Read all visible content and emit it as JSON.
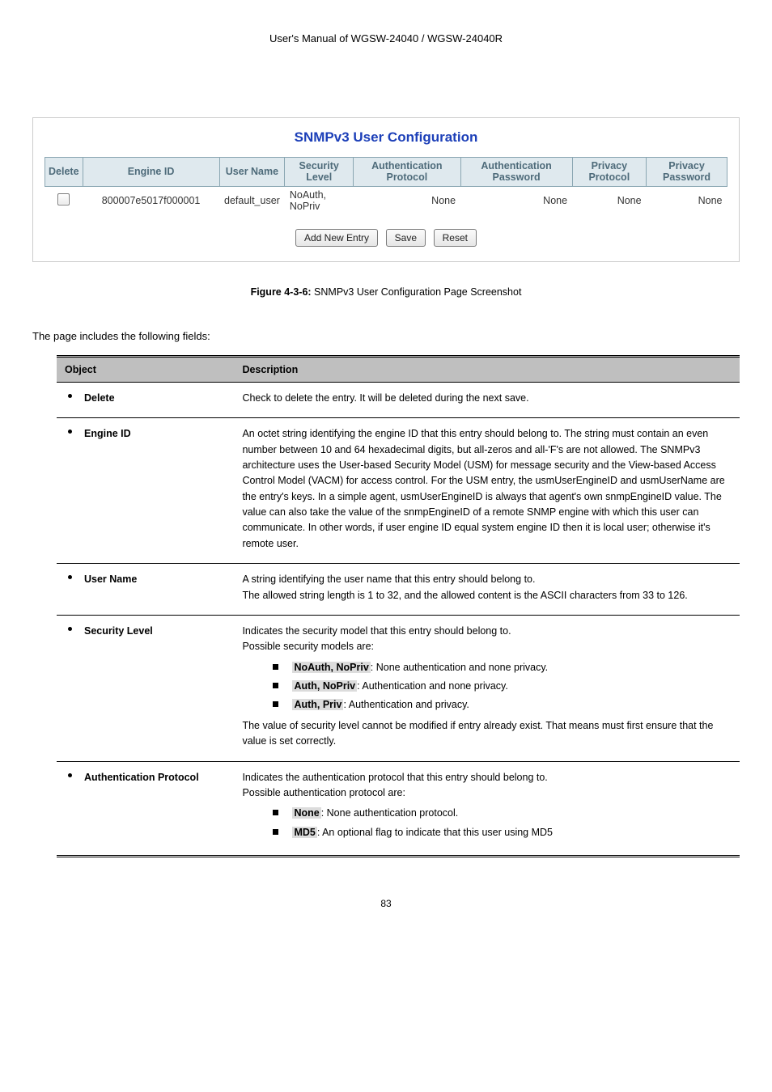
{
  "header_line": "User's Manual of WGSW-24040 / WGSW-24040R",
  "screenshot": {
    "title": "SNMPv3 User Configuration",
    "columns": [
      "Delete",
      "Engine ID",
      "User Name",
      "Security Level",
      "Authentication Protocol",
      "Authentication Password",
      "Privacy Protocol",
      "Privacy Password"
    ],
    "row": {
      "engine_id": "800007e5017f000001",
      "user_name": "default_user",
      "security_level": "NoAuth, NoPriv",
      "auth_protocol": "None",
      "auth_password": "None",
      "priv_protocol": "None",
      "priv_password": "None"
    },
    "buttons": {
      "add": "Add New Entry",
      "save": "Save",
      "reset": "Reset"
    }
  },
  "figure_caption_strong": "Figure 4-3-6:",
  "figure_caption_rest": " SNMPv3 User Configuration Page Screenshot",
  "lead": "The page includes the following fields:",
  "desc_table": {
    "head_object": "Object",
    "head_description": "Description",
    "rows": [
      {
        "name": "Delete",
        "desc_lines": [
          "Check to delete the entry. It will be deleted during the next save."
        ]
      },
      {
        "name": "Engine ID",
        "desc_lines": [
          "An octet string identifying the engine ID that this entry should belong to. The string must contain an even number between 10 and 64 hexadecimal digits, but all-zeros and all-'F's are not allowed. The SNMPv3 architecture uses the User-based Security Model (USM) for message security and the View-based Access Control Model (VACM) for access control. For the USM entry, the usmUserEngineID and usmUserName are the entry's keys. In a simple agent, usmUserEngineID is always that agent's own snmpEngineID value. The value can also take the value of the snmpEngineID of a remote SNMP engine with which this user can communicate. In other words, if user engine ID equal system engine ID then it is local user; otherwise it's remote user."
        ]
      },
      {
        "name": "User Name",
        "desc_lines": [
          "A string identifying the user name that this entry should belong to.",
          "The allowed string length is 1 to 32, and the allowed content is the ASCII characters from 33 to 126."
        ]
      },
      {
        "name": "Security Level",
        "desc_lines": [
          "Indicates the security model that this entry should belong to.",
          "Possible security models are:"
        ],
        "bullets": [
          {
            "hl": "NoAuth, NoPriv",
            "after": ": None authentication and none privacy."
          },
          {
            "hl": "Auth, NoPriv",
            "after": ": Authentication and none privacy."
          },
          {
            "hl": "Auth, Priv",
            "after": ": Authentication and privacy."
          }
        ],
        "trailing": "The value of security level cannot be modified if entry already exist. That means must first ensure that the value is set correctly."
      },
      {
        "name": "Authentication Protocol",
        "desc_lines": [
          "Indicates the authentication protocol that this entry should belong to.",
          "Possible authentication protocol are:"
        ],
        "bullets": [
          {
            "hl": "None",
            "after": ": None authentication protocol."
          },
          {
            "hl": "MD5",
            "after": ": An optional flag to indicate that this user using MD5"
          }
        ]
      }
    ]
  },
  "page_number": "83"
}
